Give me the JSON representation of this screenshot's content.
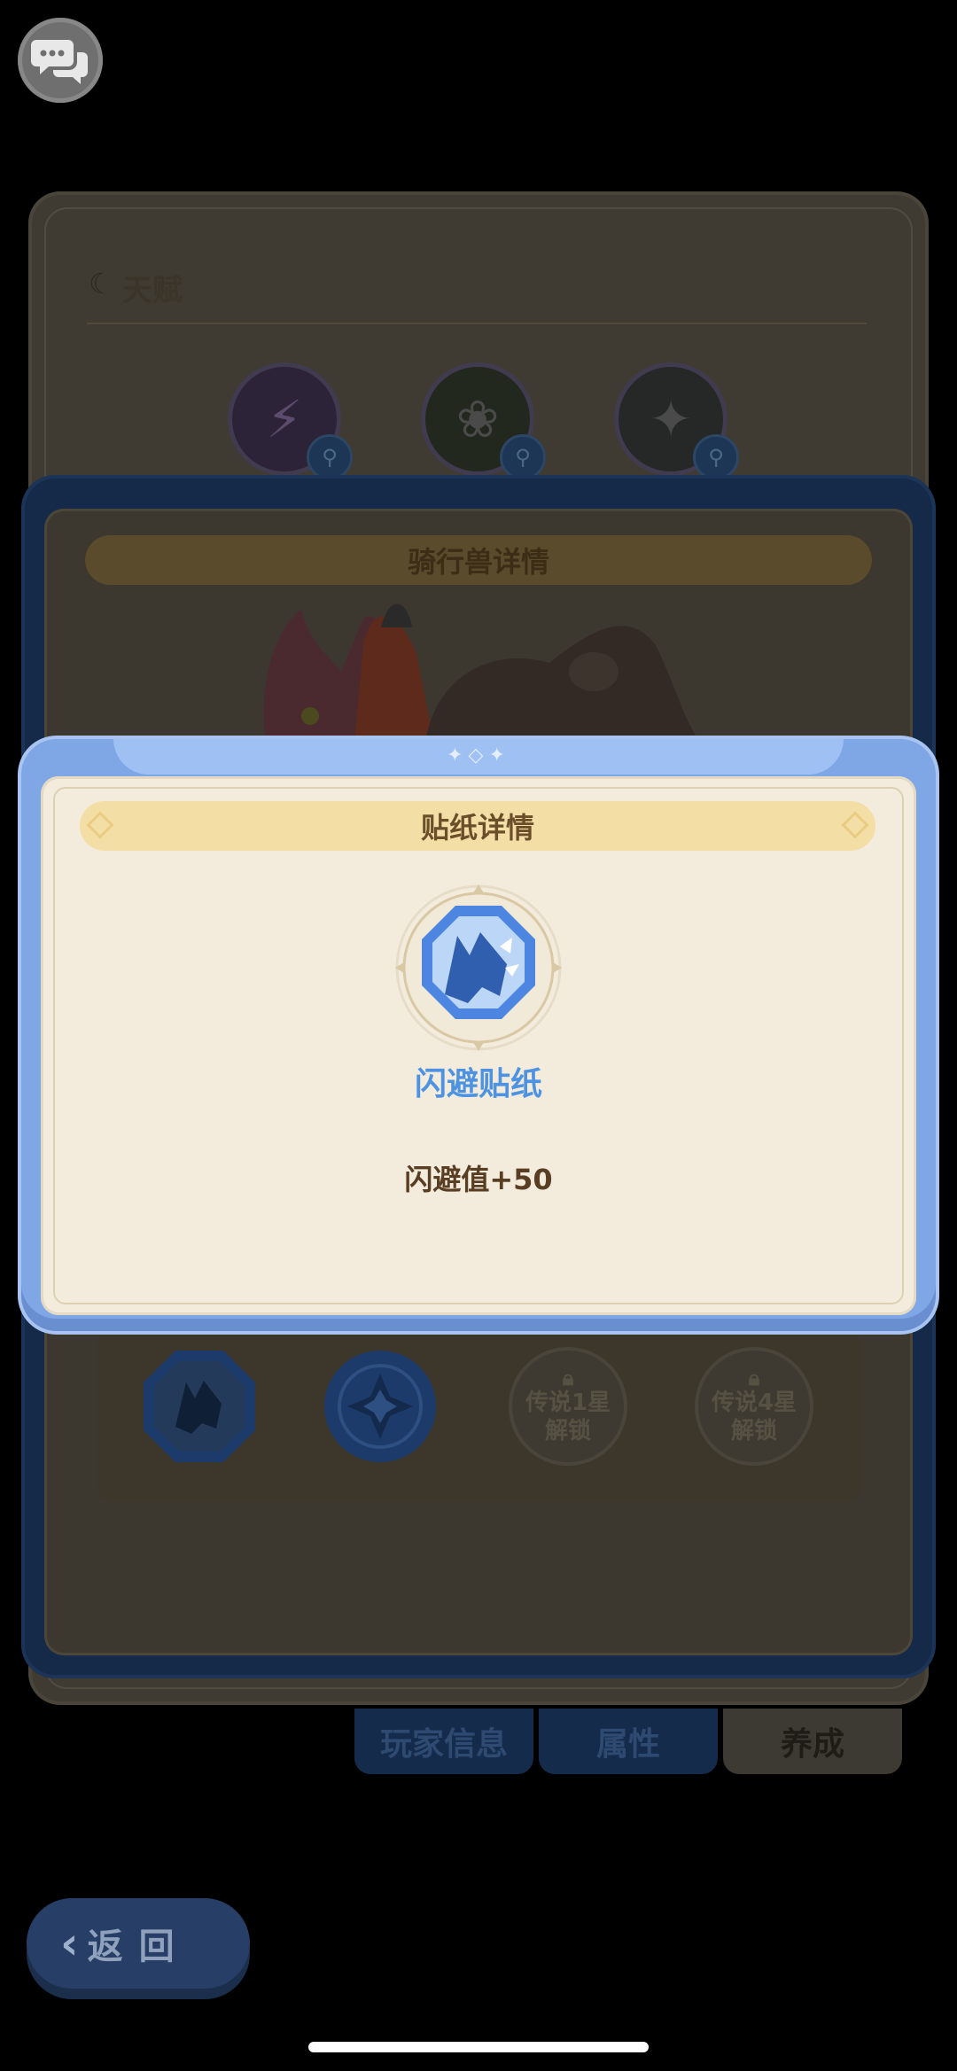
{
  "background": {
    "talent_section": {
      "title": "天赋",
      "icons": [
        "lightning-talent-icon",
        "flower-talent-icon",
        "star-talent-icon"
      ]
    },
    "mount_detail": {
      "title": "骑行兽详情",
      "sticker_slots": [
        {
          "type": "sticker",
          "icon": "wolf-sticker-icon"
        },
        {
          "type": "sticker",
          "icon": "compass-sticker-icon"
        },
        {
          "type": "locked",
          "line1": "传说1星",
          "line2": "解锁"
        },
        {
          "type": "locked",
          "line1": "传说4星",
          "line2": "解锁"
        }
      ]
    },
    "tabs": {
      "player_info": "玩家信息",
      "attributes": "属性",
      "training": "养成"
    },
    "back_button": "返回"
  },
  "dialog": {
    "title": "贴纸详情",
    "sticker_name": "闪避贴纸",
    "effect": "闪避值+50"
  },
  "colors": {
    "dialog_frame": "#7fa7e6",
    "dialog_body": "#f3ecdd",
    "banner": "#f3dfa6",
    "sticker_name": "#4d93e2",
    "effect_text": "#5a3e24"
  }
}
